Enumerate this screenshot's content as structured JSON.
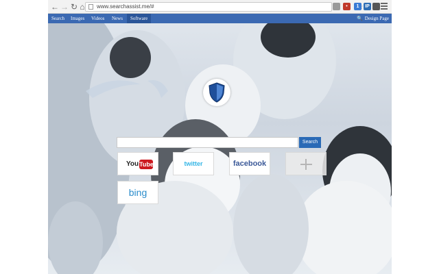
{
  "browser": {
    "url": "www.searchassist.me/#",
    "back_icon": "arrow-left-icon",
    "forward_icon": "arrow-right-icon",
    "reload_icon": "reload-icon",
    "home_icon": "home-icon",
    "extensions": [
      {
        "name": "ext-grey",
        "color": "#9a9a9a",
        "glyph": ""
      },
      {
        "name": "ext-red",
        "color": "#c0392b",
        "glyph": "•"
      },
      {
        "name": "ext-blue",
        "color": "#3a7bd5",
        "glyph": "1"
      },
      {
        "name": "ext-ip",
        "color": "#2d6db5",
        "glyph": "IP"
      },
      {
        "name": "ext-dark",
        "color": "#555555",
        "glyph": ""
      }
    ]
  },
  "toolbar": {
    "tabs": [
      "Search",
      "Images",
      "Videos",
      "News",
      "Software"
    ],
    "active_tab": "Software",
    "design_page": "Design Page",
    "accent_color": "#3b69b2"
  },
  "search": {
    "button_label": "Search",
    "value": ""
  },
  "shortcuts": [
    {
      "name": "youtube",
      "you": "You",
      "tube": "Tube"
    },
    {
      "name": "twitter",
      "label": "twitter"
    },
    {
      "name": "facebook",
      "label": "facebook"
    },
    {
      "name": "add",
      "icon": "plus-icon"
    },
    {
      "name": "bing",
      "label": "bing"
    }
  ]
}
